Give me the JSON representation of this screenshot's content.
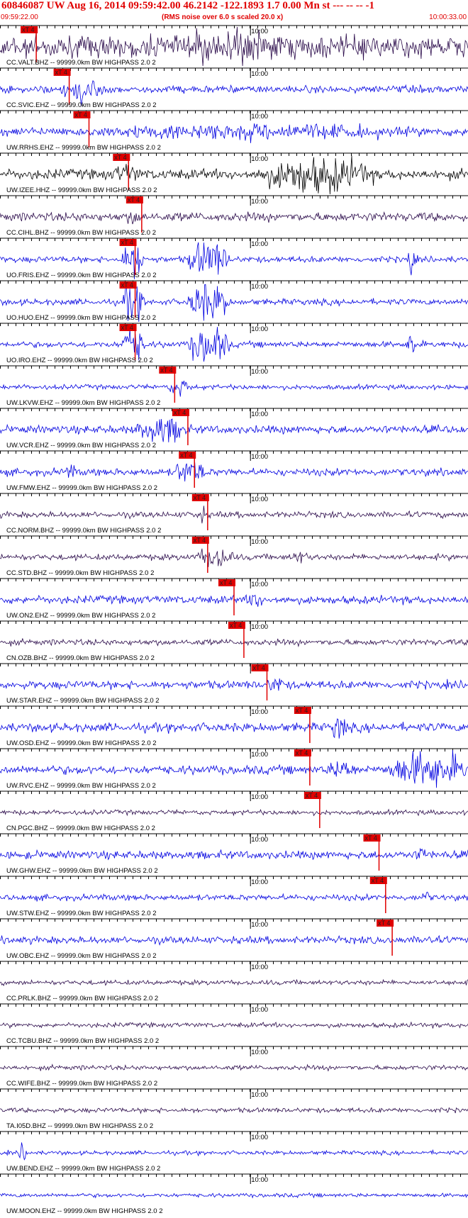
{
  "header": {
    "title": "60846087 UW Aug 16, 2014 09:59:42.00   46.2142 -122.1893  1.7 0.00 Mn st --- -- --  -1",
    "start_time": "09:59:22.00",
    "note": "(RMS noise over 6.0 s scaled 20.0 x)",
    "end_time": "10:00:33.00"
  },
  "colors": {
    "header_red": "#e00000",
    "pick_red": "#e00000",
    "blue": "#0000e0",
    "black": "#000000",
    "purple": "#2a0a4a"
  },
  "chart_data": {
    "type": "line",
    "title": "60846087 UW Aug 16, 2014 09:59:42.00   46.2142 -122.1893  1.7 0.00 Mn st --- -- --  -1",
    "x_range": [
      "09:59:22.00",
      "10:00:33.00"
    ],
    "x_tick_label": "10:00",
    "pick_label": "xT 4",
    "series": [
      {
        "label": "CC.VALT.BHZ -- 99999.0km BW  HIGHPASS  2.0  2",
        "color": "purple",
        "pick": "09:59:27.5",
        "amp": 0.55,
        "bursts": [
          [
            0.07,
            0.14,
            0.55
          ],
          [
            0.37,
            0.62,
            0.95
          ]
        ]
      },
      {
        "label": "CC.SVIC.EHZ -- 99999.0km BW  HIGHPASS  2.0  2",
        "color": "blue",
        "pick": "09:59:32.5",
        "amp": 0.18,
        "bursts": [
          [
            0.13,
            0.22,
            0.7
          ]
        ]
      },
      {
        "label": "UW.RRHS.EHZ -- 99999.0km BW  HIGHPASS  2.0  2",
        "color": "blue",
        "pick": "09:59:35.5",
        "amp": 0.22,
        "bursts": [
          [
            0.17,
            0.9,
            0.45
          ]
        ]
      },
      {
        "label": "UW.IZEE.HHZ -- 99999.0km BW  HIGHPASS  2.0  2",
        "color": "black",
        "pick": "09:59:41.5",
        "amp": 0.25,
        "bursts": [
          [
            0.24,
            0.3,
            0.6
          ],
          [
            0.55,
            0.8,
            1.0
          ]
        ]
      },
      {
        "label": "CC.CIHL.BHZ -- 99999.0km BW  HIGHPASS  2.0  2",
        "color": "purple",
        "pick": "09:59:43.5",
        "amp": 0.22,
        "bursts": [
          [
            0.27,
            0.3,
            0.5
          ]
        ]
      },
      {
        "label": "UO.FRIS.EHZ -- 99999.0km BW  HIGHPASS  2.0  2",
        "color": "blue",
        "pick": "09:59:42.5",
        "amp": 0.15,
        "bursts": [
          [
            0.26,
            0.31,
            1.0
          ],
          [
            0.4,
            0.49,
            1.0
          ],
          [
            0.87,
            0.89,
            0.9
          ]
        ]
      },
      {
        "label": "UO.HUO.EHZ -- 99999.0km BW  HIGHPASS  2.0  2",
        "color": "blue",
        "pick": "09:59:42.5",
        "amp": 0.15,
        "bursts": [
          [
            0.26,
            0.31,
            1.0
          ],
          [
            0.4,
            0.49,
            1.0
          ]
        ]
      },
      {
        "label": "UO.IRO.EHZ -- 99999.0km BW  HIGHPASS  2.0  2",
        "color": "blue",
        "pick": "09:59:42.5",
        "amp": 0.15,
        "bursts": [
          [
            0.26,
            0.31,
            1.0
          ],
          [
            0.4,
            0.49,
            1.0
          ],
          [
            0.87,
            0.89,
            0.9
          ]
        ]
      },
      {
        "label": "UW.LKVW.EHZ -- 99999.0km BW  HIGHPASS  2.0  2",
        "color": "blue",
        "pick": "09:59:48.5",
        "amp": 0.12,
        "bursts": [
          [
            0.36,
            0.41,
            0.5
          ]
        ]
      },
      {
        "label": "UW.VCR.EHZ -- 99999.0km BW  HIGHPASS  2.0  2",
        "color": "blue",
        "pick": "09:59:50.5",
        "amp": 0.2,
        "bursts": [
          [
            0.29,
            0.4,
            0.75
          ]
        ]
      },
      {
        "label": "UW.FMW.EHZ -- 99999.0km BW  HIGHPASS  2.0  2",
        "color": "blue",
        "pick": "09:59:51.5",
        "amp": 0.18,
        "bursts": [
          [
            0.14,
            0.16,
            0.5
          ],
          [
            0.37,
            0.44,
            0.7
          ]
        ]
      },
      {
        "label": "CC.NORM.BHZ -- 99999.0km BW  HIGHPASS  2.0  2",
        "color": "purple",
        "pick": "09:59:53.5",
        "amp": 0.15,
        "bursts": [
          [
            0.42,
            0.44,
            0.5
          ]
        ]
      },
      {
        "label": "CC.STD.BHZ -- 99999.0km BW  HIGHPASS  2.0  2",
        "color": "purple",
        "pick": "09:59:53.5",
        "amp": 0.15,
        "bursts": [
          [
            0.42,
            0.5,
            0.6
          ],
          [
            0.62,
            0.66,
            0.4
          ]
        ]
      },
      {
        "label": "UW.ON2.EHZ -- 99999.0km BW  HIGHPASS  2.0  2",
        "color": "blue",
        "pick": "09:59:57.5",
        "amp": 0.2,
        "bursts": [
          [
            0.53,
            0.56,
            0.6
          ]
        ]
      },
      {
        "label": "CN.OZB.BHZ -- 99999.0km BW  HIGHPASS  2.0  2",
        "color": "purple",
        "pick": "09:59:59.0",
        "amp": 0.15,
        "bursts": []
      },
      {
        "label": "UW.STAR.EHZ -- 99999.0km BW  HIGHPASS  2.0  2",
        "color": "blue",
        "pick": "10:00:02.5",
        "amp": 0.2,
        "bursts": [
          [
            0.57,
            0.61,
            0.5
          ]
        ]
      },
      {
        "label": "UW.OSD.EHZ -- 99999.0km BW  HIGHPASS  2.0  2",
        "color": "blue",
        "pick": "10:00:09.0",
        "amp": 0.22,
        "bursts": [
          [
            0.71,
            0.74,
            0.8
          ]
        ]
      },
      {
        "label": "UW.RVC.EHZ -- 99999.0km BW  HIGHPASS  2.0  2",
        "color": "blue",
        "pick": "10:00:09.0",
        "amp": 0.22,
        "bursts": [
          [
            0.7,
            0.76,
            0.6
          ],
          [
            0.83,
            1.0,
            1.0
          ]
        ]
      },
      {
        "label": "CN.PGC.BHZ -- 99999.0km BW  HIGHPASS  2.0  2",
        "color": "purple",
        "pick": "10:00:10.5",
        "amp": 0.12,
        "bursts": []
      },
      {
        "label": "UW.GHW.EHZ -- 99999.0km BW  HIGHPASS  2.0  2",
        "color": "blue",
        "pick": "10:00:19.5",
        "amp": 0.2,
        "bursts": [
          [
            0.89,
            0.91,
            0.6
          ]
        ]
      },
      {
        "label": "UW.STW.EHZ -- 99999.0km BW  HIGHPASS  2.0  2",
        "color": "blue",
        "pick": "10:00:20.5",
        "amp": 0.15,
        "bursts": [
          [
            0.9,
            0.92,
            0.4
          ]
        ]
      },
      {
        "label": "UW.OBC.EHZ -- 99999.0km BW  HIGHPASS  2.0  2",
        "color": "blue",
        "pick": "10:00:21.5",
        "amp": 0.18,
        "bursts": [
          [
            0.91,
            0.93,
            0.5
          ]
        ]
      },
      {
        "label": "CC.PRLK.BHZ -- 99999.0km BW  HIGHPASS  2.0  2",
        "color": "purple",
        "amp": 0.12,
        "bursts": []
      },
      {
        "label": "CC.TCBU.BHZ -- 99999.0km BW  HIGHPASS  2.0  2",
        "color": "purple",
        "amp": 0.12,
        "bursts": []
      },
      {
        "label": "CC.WIFE.BHZ -- 99999.0km BW  HIGHPASS  2.0  2",
        "color": "purple",
        "amp": 0.12,
        "bursts": []
      },
      {
        "label": "TA.I05D.BHZ -- 99999.0km BW  HIGHPASS  2.0  2",
        "color": "purple",
        "amp": 0.12,
        "bursts": []
      },
      {
        "label": "UW.BEND.EHZ -- 99999.0km BW  HIGHPASS  2.0  2",
        "color": "blue",
        "amp": 0.1,
        "bursts": [
          [
            0.04,
            0.06,
            0.5
          ]
        ]
      },
      {
        "label": "UW.MOON.EHZ -- 99999.0km BW  HIGHPASS  2.0  2",
        "color": "blue",
        "amp": 0.1,
        "bursts": []
      }
    ]
  }
}
